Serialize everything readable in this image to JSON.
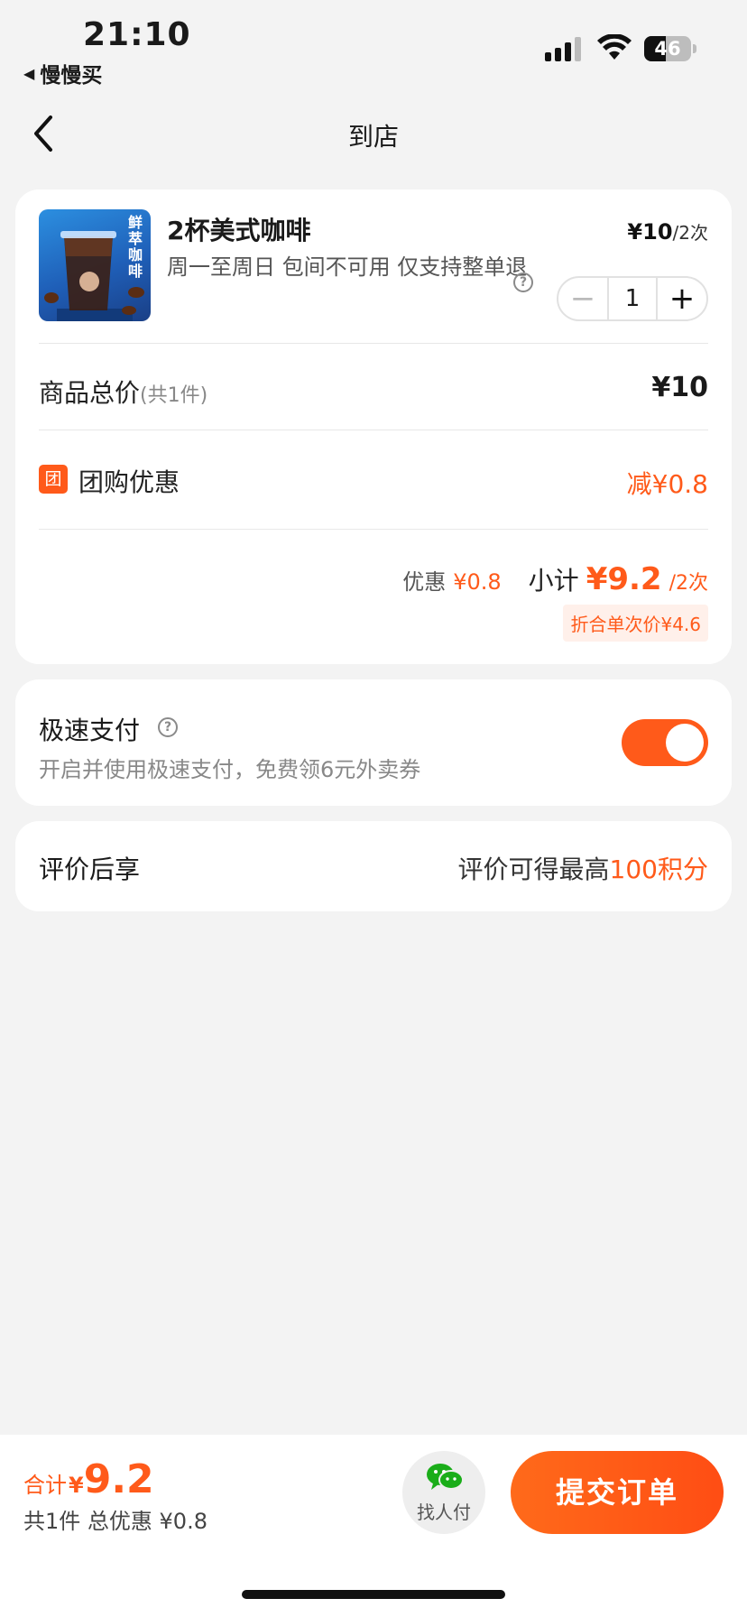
{
  "status_bar": {
    "time": "21:10",
    "back_app": "慢慢买",
    "battery": "46",
    "battery_level": 0.46
  },
  "nav": {
    "title": "到店"
  },
  "product": {
    "name": "2杯美式咖啡",
    "description": "周一至周日 包间不可用 仅支持整单退",
    "price_currency": "¥",
    "price": "10",
    "price_unit": "/2次",
    "quantity": "1",
    "minus": "−",
    "plus": "+",
    "thumbnail_text": "鲜萃咖啡"
  },
  "order": {
    "total_label": "商品总价",
    "total_count": "(共1件)",
    "total_value": "¥10",
    "groupbuy_badge": "团",
    "groupbuy_label": "团购优惠",
    "groupbuy_value": "减¥0.8",
    "discount_label": "优惠",
    "discount_value": "¥0.8",
    "subtotal_label": "小计",
    "subtotal_value": "¥9.2",
    "subtotal_unit": "/2次",
    "per_price": "折合单次价¥4.6"
  },
  "fast_pay": {
    "title": "极速支付",
    "subtitle": "开启并使用极速支付，免费领6元外卖券",
    "enabled": true
  },
  "review": {
    "title": "评价后享",
    "prefix": "评价可得最高",
    "points": "100积分"
  },
  "bottom": {
    "total_label": "合计",
    "currency": "¥",
    "total_amount": "9.2",
    "summary": "共1件  总优惠 ¥0.8",
    "find_pay": "找人付",
    "submit": "提交订单"
  },
  "colors": {
    "accent": "#ff5a1a",
    "wechat": "#1aad19"
  }
}
